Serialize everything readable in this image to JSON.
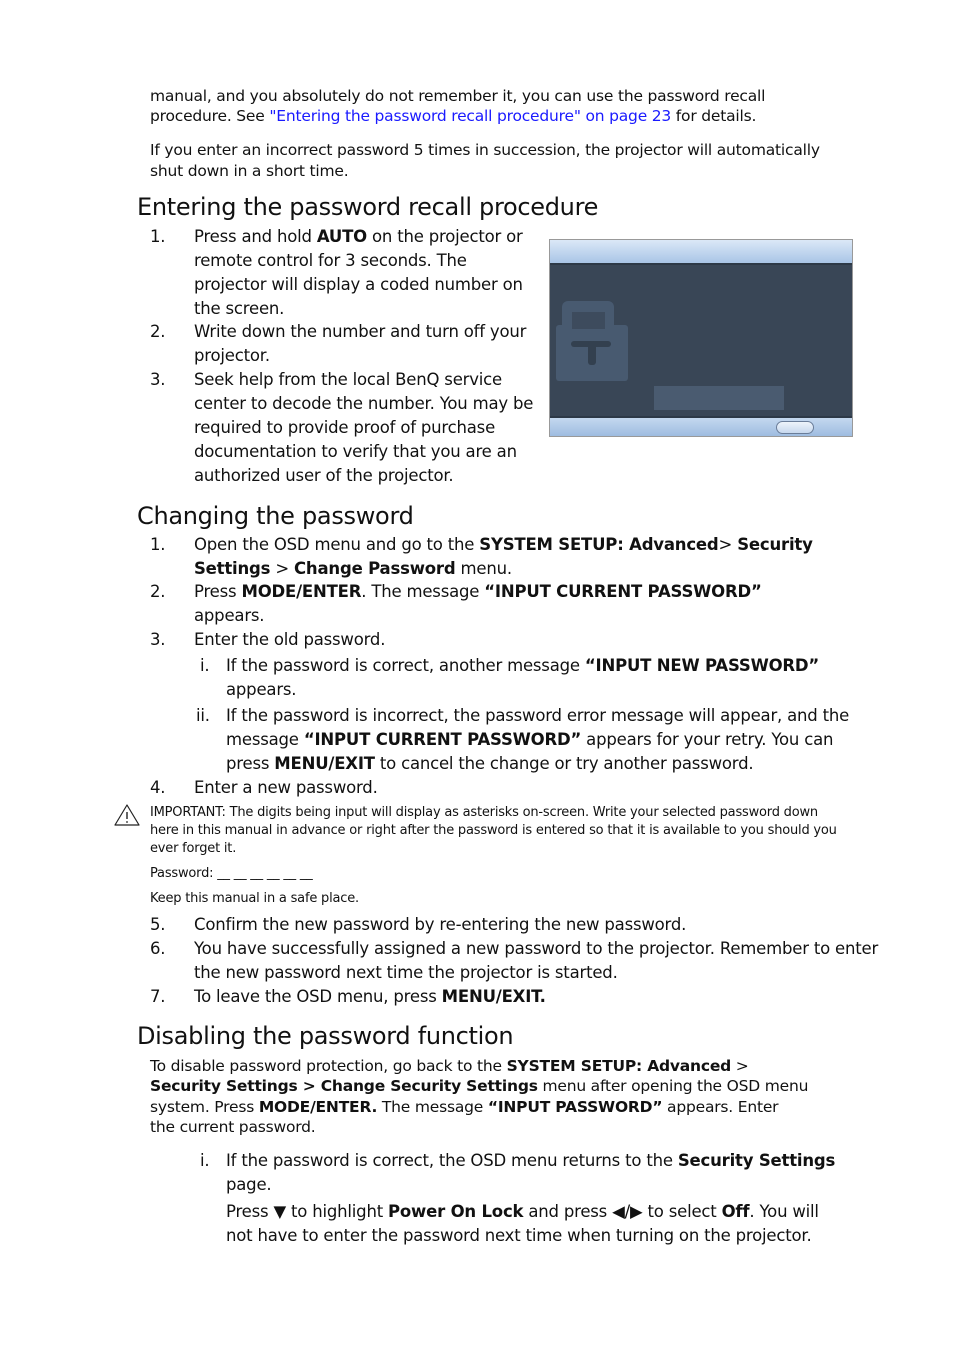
{
  "intro": {
    "line1": "manual, and you absolutely do not remember it, you can use the password recall",
    "line2_pre": "procedure. See ",
    "line2_link": "\"Entering the password recall procedure\" on page 23",
    "line2_post": " for details.",
    "para2_line1": "If you enter an incorrect password 5 times in succession, the projector will automatically",
    "para2_line2": "shut down in a short time."
  },
  "section_recall": {
    "heading": "Entering the password recall procedure",
    "steps": [
      {
        "num": "1.",
        "lines": [
          "Press and hold |AUTO| on the projector or",
          "remote control for 3 seconds. The",
          "projector will display a coded number on",
          "the screen."
        ]
      },
      {
        "num": "2.",
        "lines": [
          "Write down the number and turn off your",
          "projector."
        ]
      },
      {
        "num": "3.",
        "lines": [
          "Seek help from the local BenQ service",
          "center to decode the number. You may be",
          "required to provide proof of purchase",
          "documentation to verify that you are an",
          "authorized user of the projector."
        ]
      }
    ],
    "osd_image": "password-recall-osd-screenshot"
  },
  "section_change": {
    "heading": "Changing the password",
    "step1_num": "1.",
    "step1_a": "Open the OSD menu and go to the ",
    "step1_b": "SYSTEM SETUP: Advanced",
    "step1_c": "> ",
    "step1_d": "Security",
    "step1_e": "Settings",
    "step1_f": " > ",
    "step1_g": "Change Password",
    "step1_h": " menu.",
    "step2_num": "2.",
    "step2_a": "Press ",
    "step2_b": "MODE/ENTER",
    "step2_c": ". The message ",
    "step2_d": "“INPUT CURRENT PASSWORD”",
    "step2_e": "appears.",
    "step3_num": "3.",
    "step3": "Enter the old password.",
    "sub_i_num": "i.",
    "sub_i_a": "If the password is correct, another message ",
    "sub_i_b": "“INPUT NEW PASSWORD”",
    "sub_i_c": "appears.",
    "sub_ii_num": "ii.",
    "sub_ii_line1": "If the password is incorrect, the password error message will appear, and the",
    "sub_ii_a": "message ",
    "sub_ii_b": "“INPUT CURRENT PASSWORD”",
    "sub_ii_c": " appears for your retry. You can",
    "sub_ii_d": "press ",
    "sub_ii_e": "MENU/EXIT",
    "sub_ii_f": " to cancel the change or try another password.",
    "step4_num": "4.",
    "step4": "Enter a new password.",
    "important_line1": "IMPORTANT: The digits being input will display as asterisks on-screen. Write your selected password down",
    "important_line2": "here in this manual in advance or right after the password is entered so that it is available to you should you",
    "important_line3": "ever forget it.",
    "password_label": "Password: __ __ __ __ __ __",
    "keep_safe": "Keep this manual in a safe place.",
    "step5_num": "5.",
    "step5": "Confirm the new password by re-entering the new password.",
    "step6_num": "6.",
    "step6_line1": "You have successfully assigned a new password to the projector. Remember to enter",
    "step6_line2": "the new password next time the projector is started.",
    "step7_num": "7.",
    "step7_a": "To leave the OSD menu, press ",
    "step7_b": "MENU/EXIT."
  },
  "section_disable": {
    "heading": "Disabling the password function",
    "l1_a": "To disable password protection, go back to the ",
    "l1_b": "SYSTEM SETUP: Advanced",
    "l1_c": " >",
    "l2_a": "Security Settings > Change Security Settings",
    "l2_b": " menu after opening the OSD menu",
    "l3_a": "system. Press ",
    "l3_b": "MODE/ENTER.",
    "l3_c": " The message ",
    "l3_d": "“INPUT PASSWORD”",
    "l3_e": " appears. Enter",
    "l4": "the current password.",
    "sub_i_num": "i.",
    "sub_i_a": "If the password is correct, the OSD menu returns to the ",
    "sub_i_b": "Security Settings",
    "sub_i_c": "page.",
    "p_a": "Press ",
    "p_down": "▼",
    "p_b": " to highlight ",
    "p_c": "Power On Lock",
    "p_d": " and press ",
    "p_lr": "◀/▶",
    "p_e": " to select ",
    "p_f": "Off",
    "p_g": ". You will",
    "p_line2": "not have to enter the password next time when turning on the projector."
  }
}
